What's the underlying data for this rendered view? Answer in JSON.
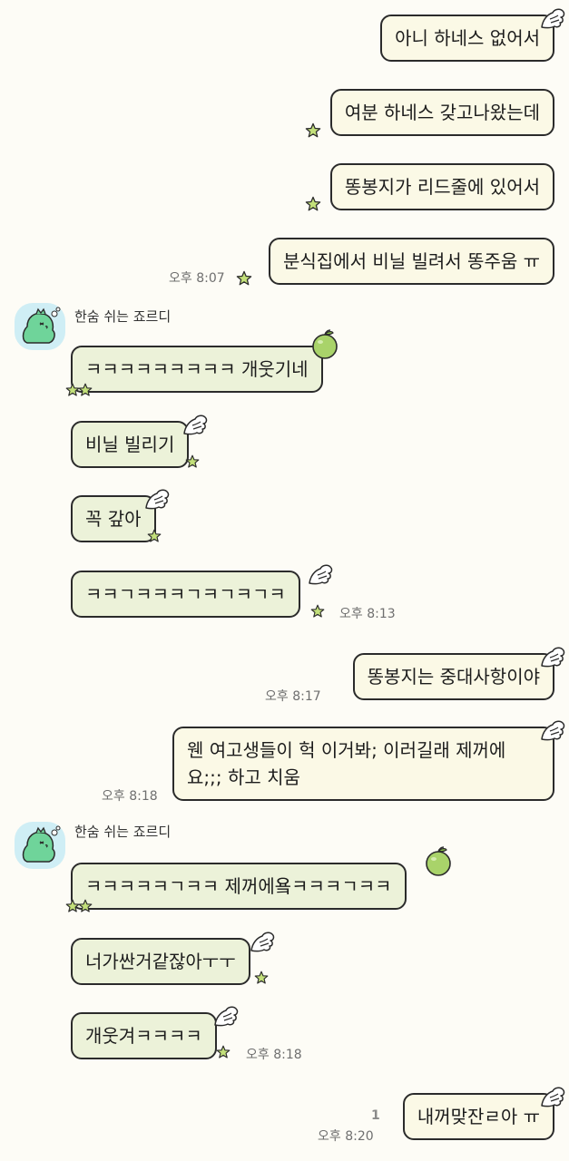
{
  "messages": [
    {
      "text": "아니 하네스 없어서"
    },
    {
      "text": "여분 하네스 갖고나왔는데"
    },
    {
      "text": "똥봉지가 리드줄에 있어서"
    },
    {
      "text": "분식집에서 비닐 빌려서 똥주움 ㅠ",
      "time": "오후 8:07"
    },
    {
      "sender": "한숨 쉬는 죠르디",
      "text": "ㅋㅋㅋㅋㅋㅋㅋㅋㅋ 개웃기네"
    },
    {
      "text": "비닐 빌리기"
    },
    {
      "text": "꼭 갚아"
    },
    {
      "text": "ㅋㅋㄱㅋㅋㅋㄱㅋㄱㅋㄱㅋ",
      "time": "오후 8:13"
    },
    {
      "text": "똥봉지는 중대사항이야",
      "time": "오후 8:17"
    },
    {
      "text": "웬 여고생들이 헉 이거봐; 이러길래 제꺼에요;;; 하고 치움",
      "time": "오후 8:18"
    },
    {
      "sender": "한숨 쉬는 죠르디",
      "text": "ㅋㅋㅋㅋㅋㄱㅋㅋ 제꺼에욬ㅋㅋㅋㄱㅋㅋ"
    },
    {
      "text": "너가싼거같잖아ㅜㅜ"
    },
    {
      "text": "개웃겨ㅋㅋㅋㅋ",
      "time": "오후 8:18"
    },
    {
      "text": "내꺼맞잔ㄹ아 ㅠ",
      "time": "오후 8:20",
      "unread": "1"
    }
  ],
  "colors": {
    "my_bubble": "#fbf9e6",
    "friend_bubble": "#ecf2d9",
    "background": "#fdfcf6"
  }
}
